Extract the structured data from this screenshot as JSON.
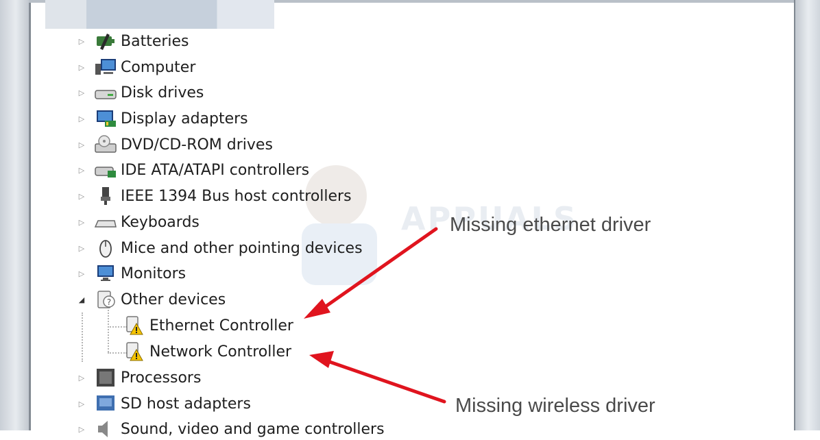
{
  "tree": {
    "items": [
      {
        "label": "Batteries",
        "icon": "battery-icon",
        "expander": "collapsed"
      },
      {
        "label": "Computer",
        "icon": "computer-icon",
        "expander": "collapsed"
      },
      {
        "label": "Disk drives",
        "icon": "disk-drive-icon",
        "expander": "collapsed"
      },
      {
        "label": "Display adapters",
        "icon": "display-adapter-icon",
        "expander": "collapsed"
      },
      {
        "label": "DVD/CD-ROM drives",
        "icon": "dvd-drive-icon",
        "expander": "collapsed"
      },
      {
        "label": "IDE ATA/ATAPI controllers",
        "icon": "ide-controller-icon",
        "expander": "collapsed"
      },
      {
        "label": "IEEE 1394 Bus host controllers",
        "icon": "firewire-icon",
        "expander": "collapsed"
      },
      {
        "label": "Keyboards",
        "icon": "keyboard-icon",
        "expander": "collapsed"
      },
      {
        "label": "Mice and other pointing devices",
        "icon": "mouse-icon",
        "expander": "collapsed"
      },
      {
        "label": "Monitors",
        "icon": "monitor-icon",
        "expander": "collapsed"
      },
      {
        "label": "Other devices",
        "icon": "unknown-device-icon",
        "expander": "expanded"
      },
      {
        "label": "Ethernet Controller",
        "icon": "warning-device-icon",
        "expander": "none"
      },
      {
        "label": "Network Controller",
        "icon": "warning-device-icon",
        "expander": "none"
      },
      {
        "label": "Processors",
        "icon": "processor-icon",
        "expander": "collapsed"
      },
      {
        "label": "SD host adapters",
        "icon": "sd-adapter-icon",
        "expander": "collapsed"
      },
      {
        "label": "Sound, video and game controllers",
        "icon": "sound-icon",
        "expander": "collapsed"
      }
    ]
  },
  "annotations": {
    "ethernet": "Missing ethernet driver",
    "wireless": "Missing wireless driver"
  },
  "colors": {
    "arrow": "#e0141e",
    "warning": "#f5c400"
  }
}
